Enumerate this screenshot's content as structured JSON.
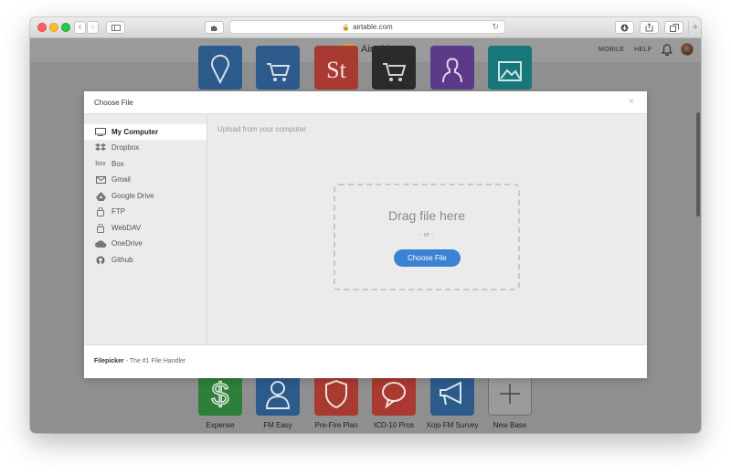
{
  "browser": {
    "url": "airtable.com",
    "new_tab_label": "+"
  },
  "app": {
    "brand": "Airtable",
    "nav": {
      "mobile": "MOBILE",
      "help": "HELP"
    }
  },
  "bases_top": [
    {
      "color": "#2c5a8a",
      "icon": "map-pin-icon"
    },
    {
      "color": "#2c5a8a",
      "icon": "cart-icon"
    },
    {
      "color": "#a83a31",
      "icon": "st-letters-icon",
      "text": "St"
    },
    {
      "color": "#2b2b2b",
      "icon": "cart-icon"
    },
    {
      "color": "#5b3a8a",
      "icon": "person-icon"
    },
    {
      "color": "#17777a",
      "icon": "image-icon"
    }
  ],
  "bases_bottom": [
    {
      "label": "Expense",
      "color": "#2d7f3a",
      "icon": "dollar-icon"
    },
    {
      "label": "FM Easy",
      "color": "#2c5a8a",
      "icon": "person-icon"
    },
    {
      "label": "Pre-Fire Plan",
      "color": "#a83a31",
      "icon": "shield-icon"
    },
    {
      "label": "ICD-10 Pros",
      "color": "#a83a31",
      "icon": "chat-icon"
    },
    {
      "label": "Xojo FM Survey",
      "color": "#2c5a8a",
      "icon": "megaphone-icon"
    },
    {
      "label": "New Base",
      "color": "#9a9a9a",
      "icon": "plus-icon"
    }
  ],
  "modal": {
    "title": "Choose File",
    "close_glyph": "×",
    "sources": [
      {
        "label": "My Computer",
        "icon": "computer-icon"
      },
      {
        "label": "Dropbox",
        "icon": "dropbox-icon"
      },
      {
        "label": "Box",
        "icon": "box-icon",
        "icon_text": "box"
      },
      {
        "label": "Gmail",
        "icon": "gmail-icon"
      },
      {
        "label": "Google Drive",
        "icon": "google-drive-icon"
      },
      {
        "label": "FTP",
        "icon": "ftp-icon"
      },
      {
        "label": "WebDAV",
        "icon": "webdav-icon"
      },
      {
        "label": "OneDrive",
        "icon": "onedrive-icon"
      },
      {
        "label": "Github",
        "icon": "github-icon"
      }
    ],
    "content_label": "Upload from your computer",
    "drag_text": "Drag file here",
    "or_text": "- or -",
    "choose_button": "Choose File",
    "footer_brand": "Filepicker",
    "footer_tagline": " - The #1 File Handler"
  }
}
